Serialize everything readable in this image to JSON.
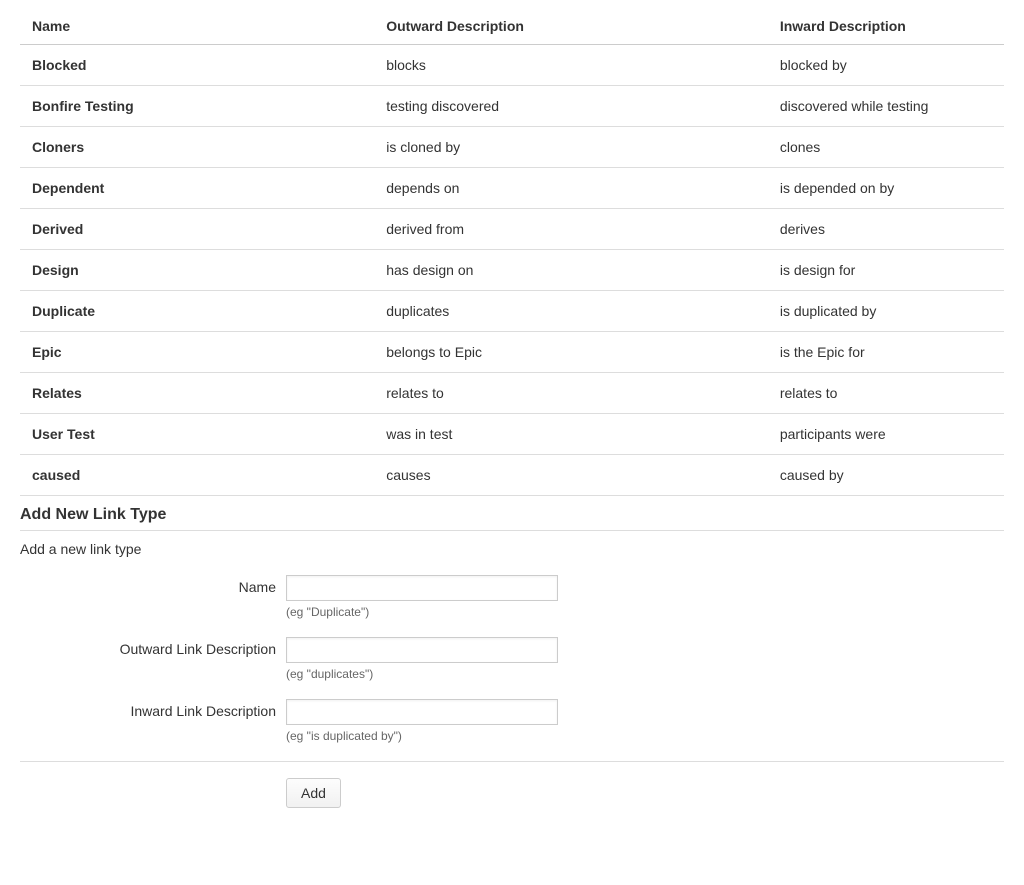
{
  "table": {
    "headers": {
      "name": "Name",
      "outward": "Outward Description",
      "inward": "Inward Description"
    },
    "rows": [
      {
        "name": "Blocked",
        "outward": "blocks",
        "inward": "blocked by"
      },
      {
        "name": "Bonfire Testing",
        "outward": "testing discovered",
        "inward": "discovered while testing"
      },
      {
        "name": "Cloners",
        "outward": "is cloned by",
        "inward": "clones"
      },
      {
        "name": "Dependent",
        "outward": "depends on",
        "inward": "is depended on by"
      },
      {
        "name": "Derived",
        "outward": "derived from",
        "inward": "derives"
      },
      {
        "name": "Design",
        "outward": "has design on",
        "inward": "is design for"
      },
      {
        "name": "Duplicate",
        "outward": "duplicates",
        "inward": "is duplicated by"
      },
      {
        "name": "Epic",
        "outward": "belongs to Epic",
        "inward": "is the Epic for"
      },
      {
        "name": "Relates",
        "outward": "relates to",
        "inward": "relates to"
      },
      {
        "name": "User Test",
        "outward": "was in test",
        "inward": "participants were"
      },
      {
        "name": "caused",
        "outward": "causes",
        "inward": "caused by"
      }
    ]
  },
  "form": {
    "title": "Add New Link Type",
    "subtitle": "Add a new link type",
    "fields": {
      "name": {
        "label": "Name",
        "value": "",
        "hint": "(eg \"Duplicate\")"
      },
      "outward": {
        "label": "Outward Link Description",
        "value": "",
        "hint": "(eg \"duplicates\")"
      },
      "inward": {
        "label": "Inward Link Description",
        "value": "",
        "hint": "(eg \"is duplicated by\")"
      }
    },
    "submit_label": "Add"
  }
}
